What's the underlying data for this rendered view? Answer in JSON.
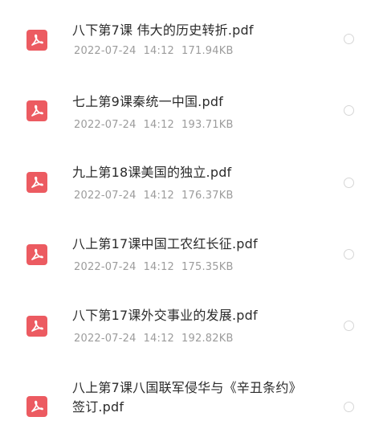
{
  "files": [
    {
      "name": "八下第7课 伟大的历史转折.pdf",
      "date": "2022-07-24",
      "time": "14:12",
      "size": "171.94KB"
    },
    {
      "name": "七上第9课秦统一中国.pdf",
      "date": "2022-07-24",
      "time": "14:12",
      "size": "193.71KB"
    },
    {
      "name": "九上第18课美国的独立.pdf",
      "date": "2022-07-24",
      "time": "14:12",
      "size": "176.37KB"
    },
    {
      "name": "八上第17课中国工农红长征.pdf",
      "date": "2022-07-24",
      "time": "14:12",
      "size": "175.35KB"
    },
    {
      "name": "八下第17课外交事业的发展.pdf",
      "date": "2022-07-24",
      "time": "14:12",
      "size": "192.82KB"
    },
    {
      "name": "八上第7课八国联军侵华与《辛丑条约》签订.pdf",
      "date": "",
      "time": "",
      "size": ""
    }
  ],
  "icons": {
    "file_type": "pdf-icon",
    "select": "radio-unchecked-icon"
  },
  "colors": {
    "pdf_icon": "#ec5b61",
    "file_name": "#2b2b2b",
    "file_meta": "#9c9c9c",
    "radio_border": "#d6d6d6"
  }
}
